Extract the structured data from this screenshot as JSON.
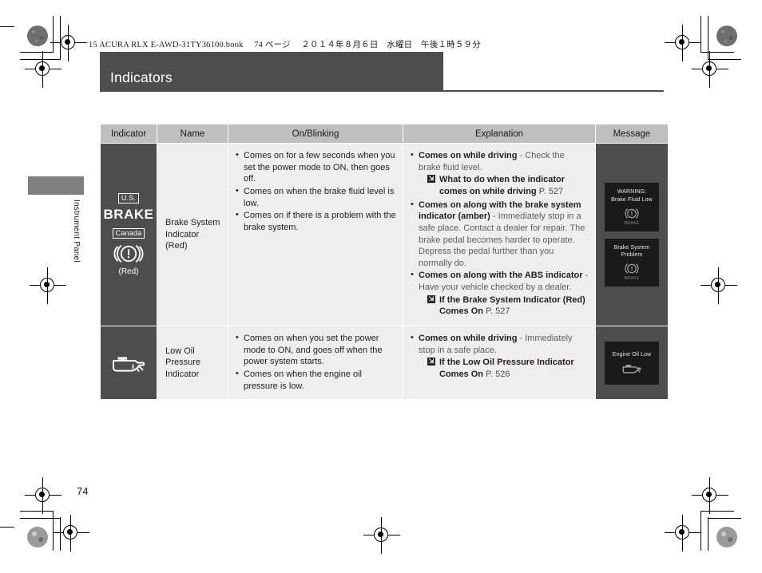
{
  "document": {
    "book_meta": "15 ACURA RLX E-AWD-31TY36100.book 　74 ページ 　２０１４年８月６日　水曜日　午後１時５９分",
    "chapter_title": "Indicators",
    "side_tab_label": "Instrument Panel",
    "page_number": "74"
  },
  "table": {
    "headers": [
      "Indicator",
      "Name",
      "On/Blinking",
      "Explanation",
      "Message"
    ],
    "rows": [
      {
        "indicator": {
          "region_us": "U.S.",
          "brake_word": "BRAKE",
          "region_canada": "Canada",
          "symbol": "brake-system-icon",
          "color_note": "(Red)"
        },
        "name": "Brake System Indicator (Red)",
        "on_blinking": [
          "Comes on for a few seconds when you set the power mode to ON, then goes off.",
          "Comes on when the brake fluid level is low.",
          "Comes on if there is a problem with the brake system."
        ],
        "explanation": [
          {
            "lead": "Comes on while driving",
            "rest": " - Check the brake fluid level.",
            "ref": {
              "text": "What to do when the indicator comes on while driving",
              "page": "P. 527"
            }
          },
          {
            "lead": "Comes on along with the brake system indicator (amber)",
            "rest": " - Immediately stop in a safe place. Contact a dealer for repair. The brake pedal becomes harder to operate. Depress the pedal further than you normally do."
          },
          {
            "lead": "Comes on along with the ABS indicator",
            "rest": " - Have your vehicle checked by a dealer.",
            "ref": {
              "text": "If the Brake System Indicator (Red) Comes On",
              "page": "P. 527"
            }
          }
        ],
        "messages": [
          {
            "lines": [
              "WARNING:",
              "Brake Fluid Low"
            ],
            "icon": "brake-system-icon",
            "icon_label": "BRAKE"
          },
          {
            "lines": [
              "Brake System",
              "Problem"
            ],
            "icon": "brake-system-icon",
            "icon_label": "BRAKE"
          }
        ]
      },
      {
        "indicator": {
          "symbol": "low-oil-pressure-icon"
        },
        "name": "Low Oil Pressure Indicator",
        "on_blinking": [
          "Comes on when you set the power mode to ON, and goes off when the power system starts.",
          "Comes on when the engine oil pressure is low."
        ],
        "explanation": [
          {
            "lead": "Comes on while driving",
            "rest": " - Immediately stop in a safe place.",
            "ref": {
              "text": "If the Low Oil Pressure Indicator Comes On",
              "page": "P. 526"
            }
          }
        ],
        "messages": [
          {
            "lines": [
              "Engine Oil Low"
            ],
            "icon": "low-oil-pressure-icon",
            "icon_label": ""
          }
        ]
      }
    ]
  },
  "colors": {
    "band": "#4d4d4d",
    "header_cell": "#bfbfbf",
    "body_cell": "#eeeeee",
    "display_panel": "#1a1a1a"
  }
}
